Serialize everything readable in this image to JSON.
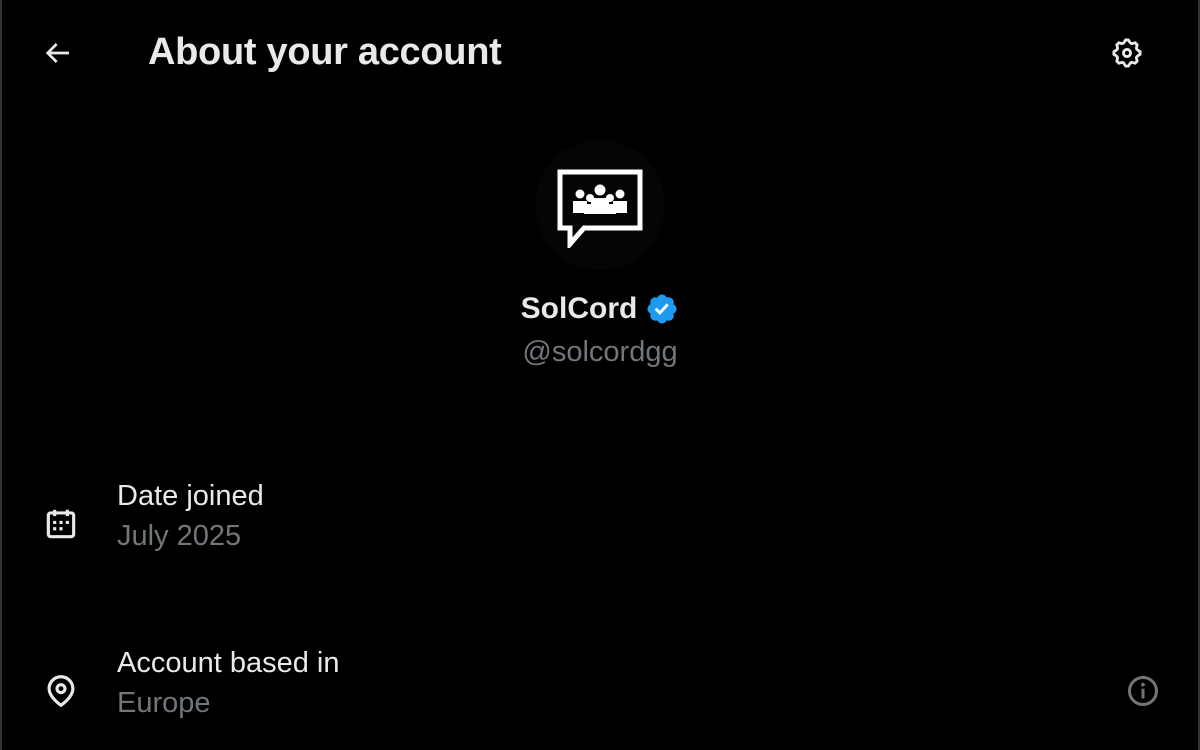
{
  "header": {
    "title": "About your account",
    "back_icon": "arrow-left-icon",
    "settings_icon": "gear-icon"
  },
  "profile": {
    "avatar_icon": "community-chat-icon",
    "display_name": "SolCord",
    "verified": true,
    "verified_color": "#1d9bf0",
    "handle": "@solcordgg"
  },
  "details": {
    "date_joined": {
      "icon": "calendar-icon",
      "label": "Date joined",
      "value": "July 2025"
    },
    "account_based_in": {
      "icon": "location-pin-icon",
      "label": "Account based in",
      "value": "Europe",
      "info_icon": "info-icon"
    }
  },
  "colors": {
    "background": "#000000",
    "primary_text": "#e7e9ea",
    "secondary_text": "#71767b",
    "accent": "#1d9bf0"
  }
}
